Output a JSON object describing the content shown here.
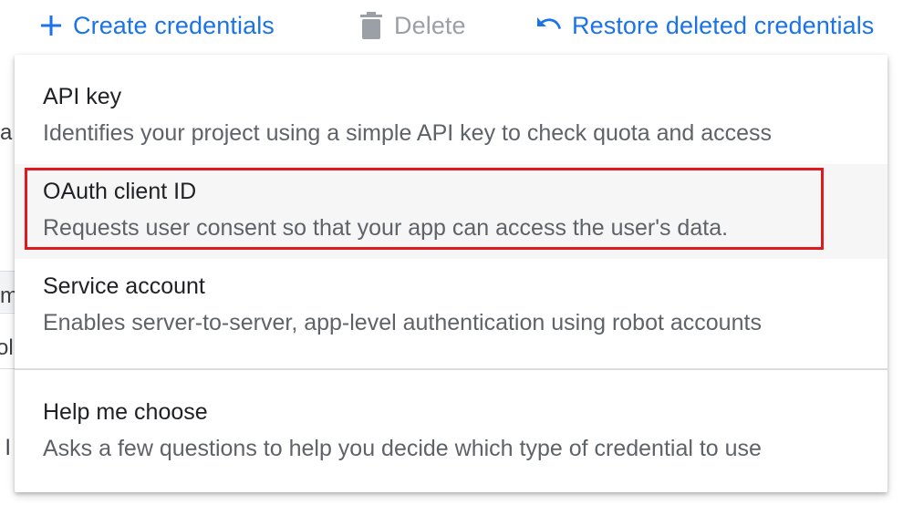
{
  "toolbar": {
    "create_label": "Create credentials",
    "delete_label": "Delete",
    "restore_label": "Restore deleted credentials"
  },
  "background": {
    "frag_a": "a",
    "frag_m": "m",
    "frag_ol": "ol",
    "frag_l": "l"
  },
  "menu": {
    "items": [
      {
        "title": "API key",
        "description": "Identifies your project using a simple API key to check quota and access"
      },
      {
        "title": "OAuth client ID",
        "description": "Requests user consent so that your app can access the user's data."
      },
      {
        "title": "Service account",
        "description": "Enables server-to-server, app-level authentication using robot accounts"
      },
      {
        "title": "Help me choose",
        "description": "Asks a few questions to help you decide which type of credential to use"
      }
    ]
  },
  "colors": {
    "accent": "#1a73e8",
    "disabled": "#9aa0a6",
    "highlight_border": "#e0191f",
    "hover_bg": "#f5f6f5"
  },
  "icons": {
    "create": "plus-icon",
    "delete": "trash-icon",
    "restore": "undo-icon"
  }
}
